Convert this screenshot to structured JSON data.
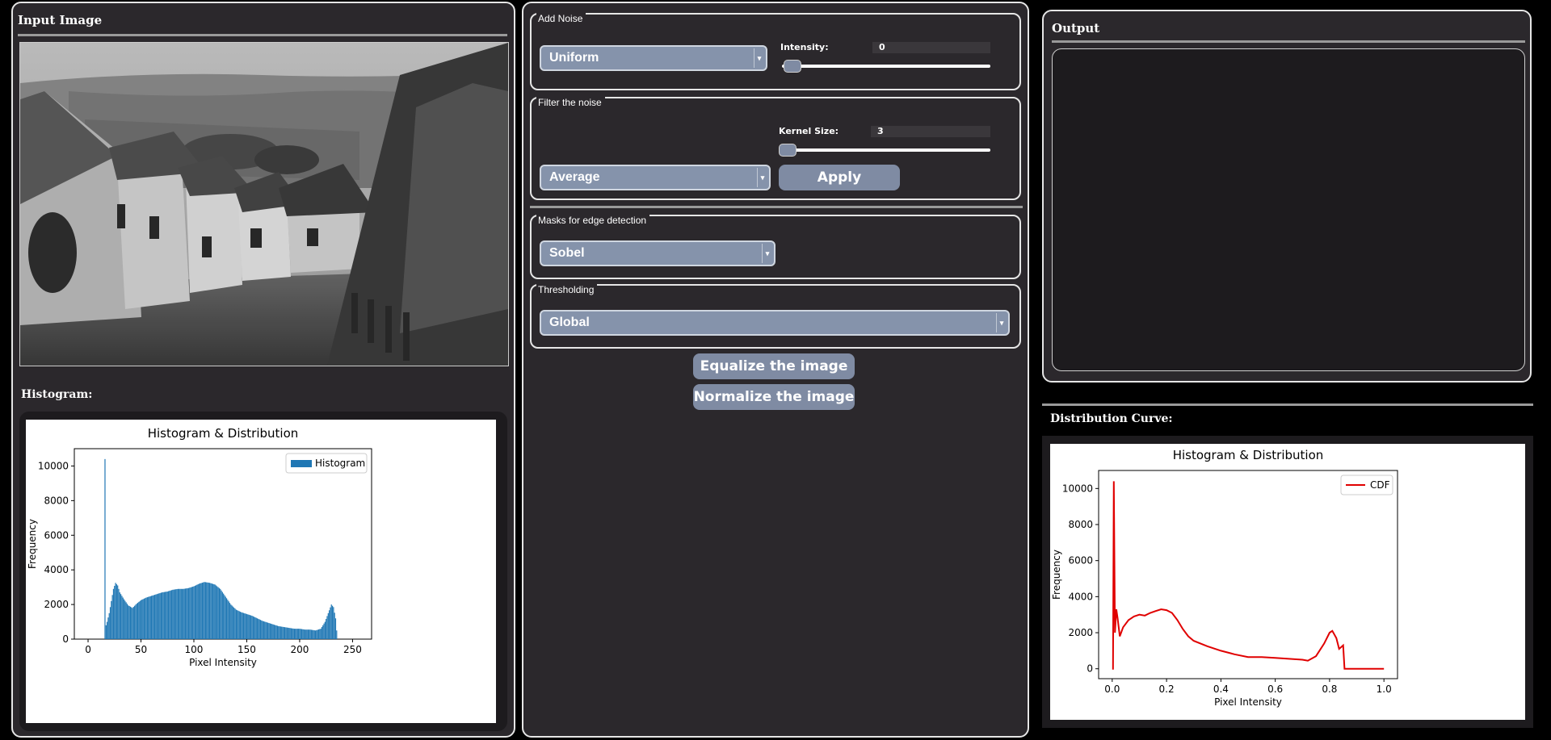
{
  "left": {
    "title": "Input Image",
    "histogram_title": "Histogram:"
  },
  "middle": {
    "noise": {
      "label": "Add Noise",
      "selected": "Uniform",
      "intensity_label": "Intensity:",
      "intensity_value": "0"
    },
    "filter": {
      "label": "Filter the noise",
      "kernel_label": "Kernel Size:",
      "kernel_value": "3",
      "selected": "Average",
      "apply_label": "Apply"
    },
    "edge": {
      "label": "Masks for edge detection",
      "selected": "Sobel"
    },
    "threshold": {
      "label": "Thresholding",
      "selected": "Global"
    },
    "equalize_label": "Equalize the image",
    "normalize_label": "Normalize the image"
  },
  "right": {
    "output_title": "Output",
    "distribution_title": "Distribution Curve:"
  },
  "icons": {
    "dropdown": "chevron-down-icon"
  },
  "colors": {
    "bar": "#1f77b4",
    "cdf": "#e00000",
    "button": "#7f8ba3"
  },
  "chart_data": [
    {
      "type": "bar",
      "title": "Histogram & Distribution",
      "xlabel": "Pixel Intensity",
      "ylabel": "Frequency",
      "legend": [
        "Histogram"
      ],
      "legend_position": "top-right",
      "xlim": [
        -13,
        268
      ],
      "ylim": [
        0,
        11000
      ],
      "xticks": [
        "0",
        "50",
        "100",
        "150",
        "200",
        "250"
      ],
      "yticks": [
        "0",
        "2000",
        "4000",
        "6000",
        "8000",
        "10000"
      ],
      "series": [
        {
          "name": "Histogram",
          "points": [
            [
              16,
              10400
            ],
            [
              17,
              800
            ],
            [
              18,
              1000
            ],
            [
              20,
              1500
            ],
            [
              22,
              2200
            ],
            [
              24,
              2900
            ],
            [
              26,
              3250
            ],
            [
              28,
              3100
            ],
            [
              30,
              2700
            ],
            [
              34,
              2300
            ],
            [
              38,
              1950
            ],
            [
              42,
              1800
            ],
            [
              46,
              2050
            ],
            [
              50,
              2250
            ],
            [
              55,
              2400
            ],
            [
              60,
              2500
            ],
            [
              65,
              2600
            ],
            [
              70,
              2700
            ],
            [
              75,
              2750
            ],
            [
              80,
              2850
            ],
            [
              85,
              2900
            ],
            [
              90,
              2900
            ],
            [
              95,
              2950
            ],
            [
              100,
              3050
            ],
            [
              105,
              3200
            ],
            [
              110,
              3300
            ],
            [
              115,
              3250
            ],
            [
              120,
              3150
            ],
            [
              125,
              2900
            ],
            [
              130,
              2450
            ],
            [
              135,
              2000
            ],
            [
              140,
              1700
            ],
            [
              145,
              1550
            ],
            [
              150,
              1450
            ],
            [
              155,
              1350
            ],
            [
              160,
              1200
            ],
            [
              165,
              1050
            ],
            [
              170,
              950
            ],
            [
              175,
              850
            ],
            [
              180,
              750
            ],
            [
              185,
              700
            ],
            [
              190,
              650
            ],
            [
              195,
              600
            ],
            [
              200,
              600
            ],
            [
              205,
              550
            ],
            [
              210,
              550
            ],
            [
              215,
              500
            ],
            [
              220,
              600
            ],
            [
              224,
              1000
            ],
            [
              227,
              1500
            ],
            [
              230,
              2000
            ],
            [
              232,
              1850
            ],
            [
              234,
              1200
            ],
            [
              235,
              500
            ]
          ]
        }
      ]
    },
    {
      "type": "line",
      "title": "Histogram & Distribution",
      "xlabel": "Pixel Intensity",
      "ylabel": "Frequency",
      "legend": [
        "CDF"
      ],
      "legend_position": "top-right",
      "xlim": [
        -0.05,
        1.05
      ],
      "ylim": [
        -550,
        11000
      ],
      "xticks": [
        "0.0",
        "0.2",
        "0.4",
        "0.6",
        "0.8",
        "1.0"
      ],
      "yticks": [
        "0",
        "2000",
        "4000",
        "6000",
        "8000",
        "10000"
      ],
      "series": [
        {
          "name": "CDF",
          "points": [
            [
              0,
              0
            ],
            [
              0.003,
              0
            ],
            [
              0.006,
              10400
            ],
            [
              0.01,
              2000
            ],
            [
              0.015,
              3300
            ],
            [
              0.02,
              2800
            ],
            [
              0.028,
              1800
            ],
            [
              0.04,
              2300
            ],
            [
              0.06,
              2700
            ],
            [
              0.08,
              2900
            ],
            [
              0.1,
              3000
            ],
            [
              0.12,
              2950
            ],
            [
              0.14,
              3100
            ],
            [
              0.16,
              3200
            ],
            [
              0.18,
              3300
            ],
            [
              0.2,
              3250
            ],
            [
              0.22,
              3100
            ],
            [
              0.24,
              2700
            ],
            [
              0.26,
              2200
            ],
            [
              0.28,
              1800
            ],
            [
              0.3,
              1550
            ],
            [
              0.35,
              1250
            ],
            [
              0.4,
              1000
            ],
            [
              0.45,
              800
            ],
            [
              0.5,
              650
            ],
            [
              0.55,
              650
            ],
            [
              0.6,
              600
            ],
            [
              0.65,
              550
            ],
            [
              0.7,
              500
            ],
            [
              0.72,
              450
            ],
            [
              0.75,
              700
            ],
            [
              0.78,
              1400
            ],
            [
              0.8,
              2000
            ],
            [
              0.81,
              2100
            ],
            [
              0.825,
              1700
            ],
            [
              0.835,
              1100
            ],
            [
              0.85,
              1300
            ],
            [
              0.855,
              0
            ],
            [
              0.9,
              0
            ],
            [
              1.0,
              0
            ]
          ]
        }
      ]
    }
  ]
}
